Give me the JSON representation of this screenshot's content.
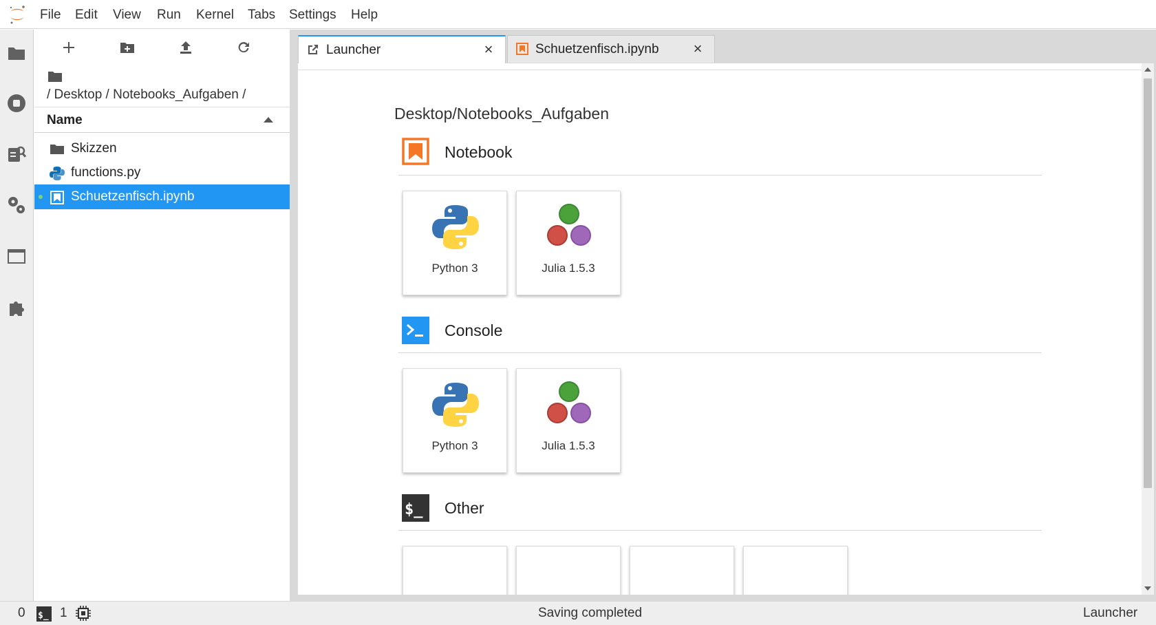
{
  "menubar": {
    "items": [
      "File",
      "Edit",
      "View",
      "Run",
      "Kernel",
      "Tabs",
      "Settings",
      "Help"
    ]
  },
  "activitybar": {
    "icons": [
      "folder-icon",
      "running-icon",
      "commands-icon",
      "property-inspector-icon",
      "tabs-icon",
      "extension-icon"
    ]
  },
  "filebrowser": {
    "breadcrumbs": "/ Desktop / Notebooks_Aufgaben /",
    "column_name": "Name",
    "files": [
      {
        "name": "Skizzen",
        "type": "folder"
      },
      {
        "name": "functions.py",
        "type": "python"
      },
      {
        "name": "Schuetzenfisch.ipynb",
        "type": "notebook",
        "selected": true,
        "running": true
      }
    ]
  },
  "tabs": [
    {
      "label": "Launcher",
      "active": true
    },
    {
      "label": "Schuetzenfisch.ipynb",
      "active": false
    }
  ],
  "launcher": {
    "cwd": "Desktop/Notebooks_Aufgaben",
    "sections": {
      "notebook": {
        "title": "Notebook",
        "cards": [
          {
            "label": "Python 3",
            "icon": "python-icon"
          },
          {
            "label": "Julia 1.5.3",
            "icon": "julia-icon"
          }
        ]
      },
      "console": {
        "title": "Console",
        "cards": [
          {
            "label": "Python 3",
            "icon": "python-icon"
          },
          {
            "label": "Julia 1.5.3",
            "icon": "julia-icon"
          }
        ]
      },
      "other": {
        "title": "Other"
      }
    }
  },
  "statusbar": {
    "terminals": "0",
    "kernels": "1",
    "status": "Saving completed",
    "mode": "Launcher"
  },
  "colors": {
    "accent": "#2196f3",
    "notebook_orange": "#f37726",
    "console_blue": "#2196f3",
    "other_dark": "#333333"
  }
}
